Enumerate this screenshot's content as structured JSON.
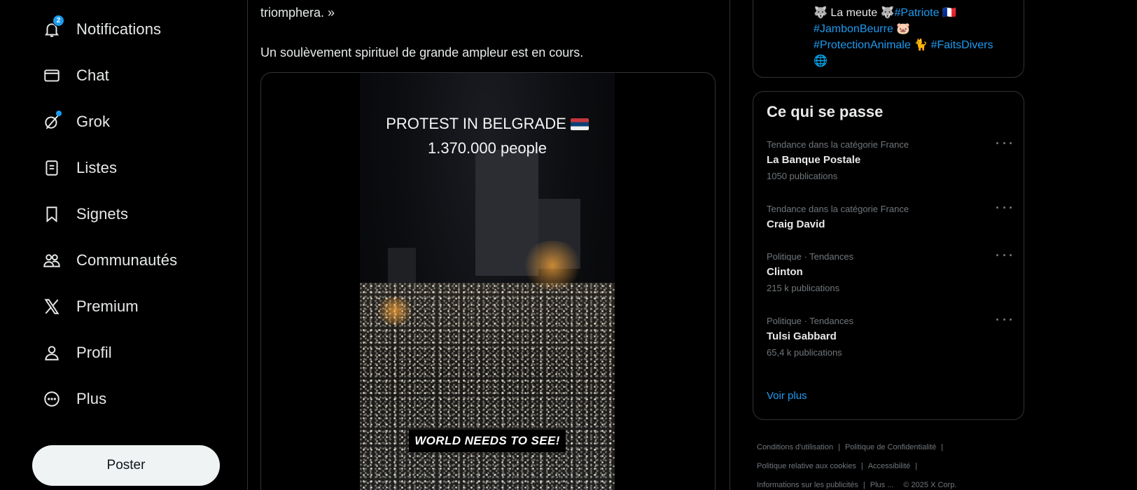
{
  "nav": {
    "items": [
      {
        "id": "notifications",
        "label": "Notifications",
        "icon": "bell-icon",
        "badge": "2"
      },
      {
        "id": "chat",
        "label": "Chat",
        "icon": "envelope-icon"
      },
      {
        "id": "grok",
        "label": "Grok",
        "icon": "grok-icon"
      },
      {
        "id": "lists",
        "label": "Listes",
        "icon": "list-icon"
      },
      {
        "id": "bookmarks",
        "label": "Signets",
        "icon": "bookmark-icon"
      },
      {
        "id": "communities",
        "label": "Communautés",
        "icon": "people-icon"
      },
      {
        "id": "premium",
        "label": "Premium",
        "icon": "x-logo-icon"
      },
      {
        "id": "profile",
        "label": "Profil",
        "icon": "person-icon"
      },
      {
        "id": "more",
        "label": "Plus",
        "icon": "more-circle-icon"
      }
    ],
    "post_label": "Poster"
  },
  "tweet": {
    "text_line1": "triomphera. »",
    "text_line2": "Un soulèvement spirituel de grande ampleur est en cours.",
    "video": {
      "title": "PROTEST IN BELGRADE",
      "subtitle": "1.370.000 people",
      "caption": "WORLD NEEDS TO SEE!"
    }
  },
  "profile_card": {
    "bio_line1_text": "La meute",
    "bio_tag1": "#Patriote",
    "bio_tag2": "#JambonBeurre",
    "bio_tag3": "#ProtectionAnimale",
    "bio_tag4": "#FaitsDivers"
  },
  "trends": {
    "title": "Ce qui se passe",
    "items": [
      {
        "category": "Tendance dans la catégorie France",
        "name": "La Banque Postale",
        "count": "1050 publications"
      },
      {
        "category": "Tendance dans la catégorie France",
        "name": "Craig David",
        "count": ""
      },
      {
        "category": "Politique · Tendances",
        "name": "Clinton",
        "count": "215 k publications"
      },
      {
        "category": "Politique · Tendances",
        "name": "Tulsi Gabbard",
        "count": "65,4 k publications"
      }
    ],
    "see_more": "Voir plus"
  },
  "footer": {
    "terms": "Conditions d'utilisation",
    "privacy": "Politique de Confidentialité",
    "cookies": "Politique relative aux cookies",
    "accessibility": "Accessibilité",
    "ads_info": "Informations sur les publicités",
    "more": "Plus ...",
    "copyright": "© 2025 X Corp."
  },
  "colors": {
    "background": "#000000",
    "accent": "#1d9bf0",
    "text": "#e7e9ea",
    "muted": "#71767b",
    "border": "#2f3336"
  }
}
